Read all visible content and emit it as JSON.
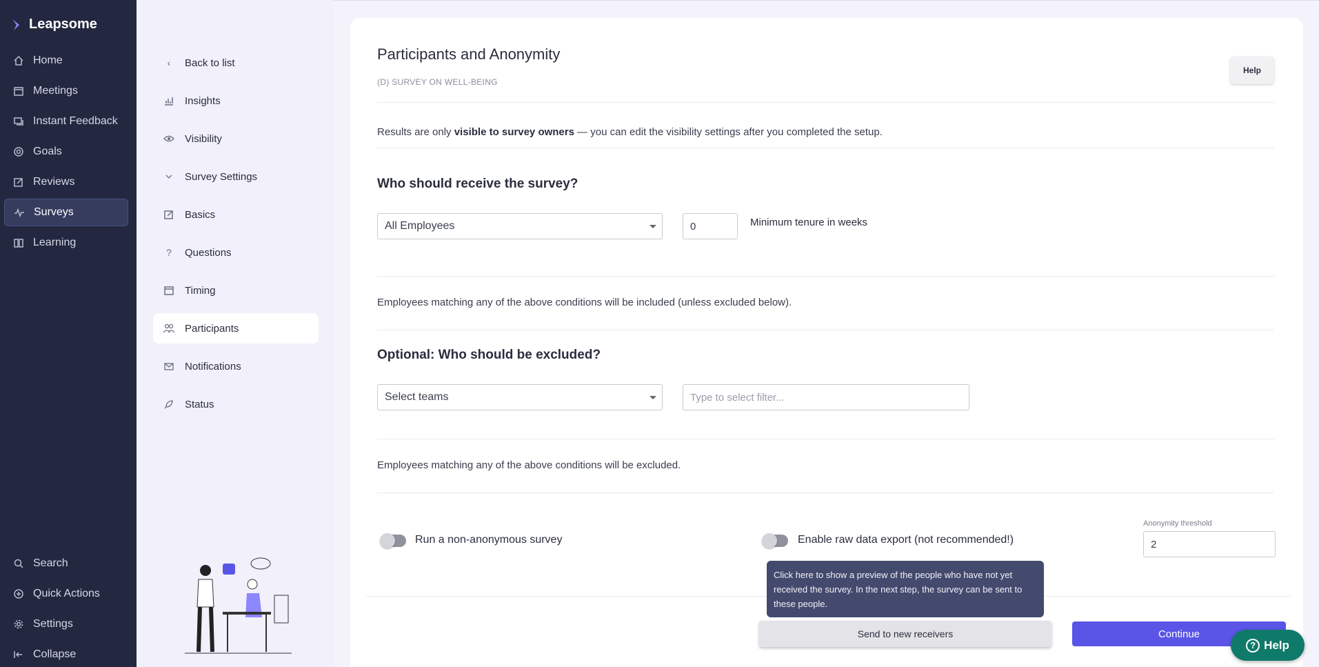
{
  "app": {
    "name": "Leapsome"
  },
  "nav": {
    "items": [
      {
        "label": "Home",
        "icon": "home-icon"
      },
      {
        "label": "Meetings",
        "icon": "calendar-icon"
      },
      {
        "label": "Instant Feedback",
        "icon": "chat-icon"
      },
      {
        "label": "Goals",
        "icon": "target-icon"
      },
      {
        "label": "Reviews",
        "icon": "edit-icon"
      },
      {
        "label": "Surveys",
        "icon": "pulse-icon",
        "active": true
      },
      {
        "label": "Learning",
        "icon": "book-icon"
      }
    ],
    "bottom": [
      {
        "label": "Search",
        "icon": "search-icon"
      },
      {
        "label": "Quick Actions",
        "icon": "plus-circle-icon"
      },
      {
        "label": "Settings",
        "icon": "gear-icon"
      },
      {
        "label": "Collapse",
        "icon": "collapse-icon"
      }
    ]
  },
  "subnav": {
    "items": [
      {
        "label": "Back to list",
        "icon": "chevron-left-icon"
      },
      {
        "label": "Insights",
        "icon": "chart-icon"
      },
      {
        "label": "Visibility",
        "icon": "eye-icon"
      },
      {
        "label": "Survey Settings",
        "icon": "chevron-down-icon"
      },
      {
        "label": "Basics",
        "icon": "edit-icon"
      },
      {
        "label": "Questions",
        "icon": "question-icon"
      },
      {
        "label": "Timing",
        "icon": "calendar-icon"
      },
      {
        "label": "Participants",
        "icon": "users-icon",
        "active": true
      },
      {
        "label": "Notifications",
        "icon": "mail-icon"
      },
      {
        "label": "Status",
        "icon": "rocket-icon"
      }
    ]
  },
  "main": {
    "title": "Participants and Anonymity",
    "breadcrumb": "(D) SURVEY ON WELL-BEING",
    "help_label": "Help",
    "visibility_prefix": "Results are only ",
    "visibility_bold": "visible to survey owners",
    "visibility_suffix": " — you can edit the visibility settings after you completed the setup.",
    "receive_heading": "Who should receive the survey?",
    "receive_select": "All Employees",
    "tenure_value": "0",
    "tenure_label": "Minimum tenure in weeks",
    "included_note": "Employees matching any of the above conditions will be included (unless excluded below).",
    "exclude_heading": "Optional: Who should be excluded?",
    "exclude_select": "Select teams",
    "filter_placeholder": "Type to select filter...",
    "excluded_note": "Employees matching any of the above conditions will be excluded.",
    "non_anonymous_label": "Run a non-anonymous survey",
    "raw_export_label": "Enable raw data export (not recommended!)",
    "anonymity_label": "Anonymity threshold",
    "anonymity_value": "2",
    "tooltip": "Click here to show a preview of the people who have not yet received the survey. In the next step, the survey can be sent to these people.",
    "send_button": "Send to new receivers",
    "continue_button": "Continue",
    "help_float": "Help"
  }
}
